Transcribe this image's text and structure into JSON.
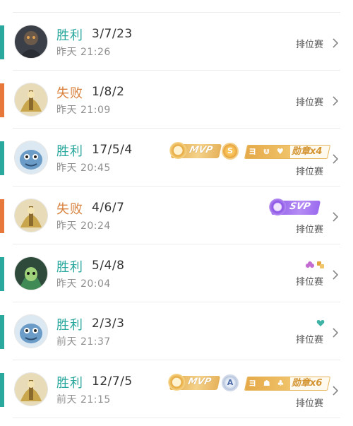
{
  "matches": [
    {
      "result": "胜利",
      "outcome": "win",
      "kda": "3/7/23",
      "time": "昨天 21:26",
      "mode": "排位赛",
      "hero_avatar": "dark-warrior-avatar",
      "badges": []
    },
    {
      "result": "失败",
      "outcome": "loss",
      "kda": "1/8/2",
      "time": "昨天 21:09",
      "mode": "排位赛",
      "hero_avatar": "golden-warrior-avatar",
      "badges": []
    },
    {
      "result": "胜利",
      "outcome": "win",
      "kda": "17/5/4",
      "time": "昨天 20:45",
      "mode": "排位赛",
      "hero_avatar": "blue-fish-avatar",
      "badges": {
        "mvp": "MVP",
        "rank_coin": "S",
        "medal_label": "勋章x4"
      }
    },
    {
      "result": "失败",
      "outcome": "loss",
      "kda": "4/6/7",
      "time": "昨天 20:24",
      "mode": "排位赛",
      "hero_avatar": "golden-warrior-avatar",
      "badges": {
        "svp": "SVP"
      }
    },
    {
      "result": "胜利",
      "outcome": "win",
      "kda": "5/4/8",
      "time": "昨天 20:04",
      "mode": "排位赛",
      "hero_avatar": "green-hooded-avatar",
      "badges": {
        "mini_icons": [
          "flower-icon",
          "gold-emblem-icon"
        ]
      }
    },
    {
      "result": "胜利",
      "outcome": "win",
      "kda": "2/3/3",
      "time": "前天 21:37",
      "mode": "排位赛",
      "hero_avatar": "blue-fish-avatar",
      "badges": {
        "mini_icons": [
          "teal-heart-icon"
        ]
      }
    },
    {
      "result": "胜利",
      "outcome": "win",
      "kda": "12/7/5",
      "time": "前天 21:15",
      "mode": "排位赛",
      "hero_avatar": "golden-warrior-avatar",
      "badges": {
        "mvp": "MVP",
        "rank_coin": "A",
        "medal_label": "勋章x6"
      }
    }
  ],
  "colors": {
    "win": "#2aa89d",
    "loss": "#e8773c",
    "mvp_gold": "#e6b25b",
    "svp_purple": "#9b6bef"
  }
}
